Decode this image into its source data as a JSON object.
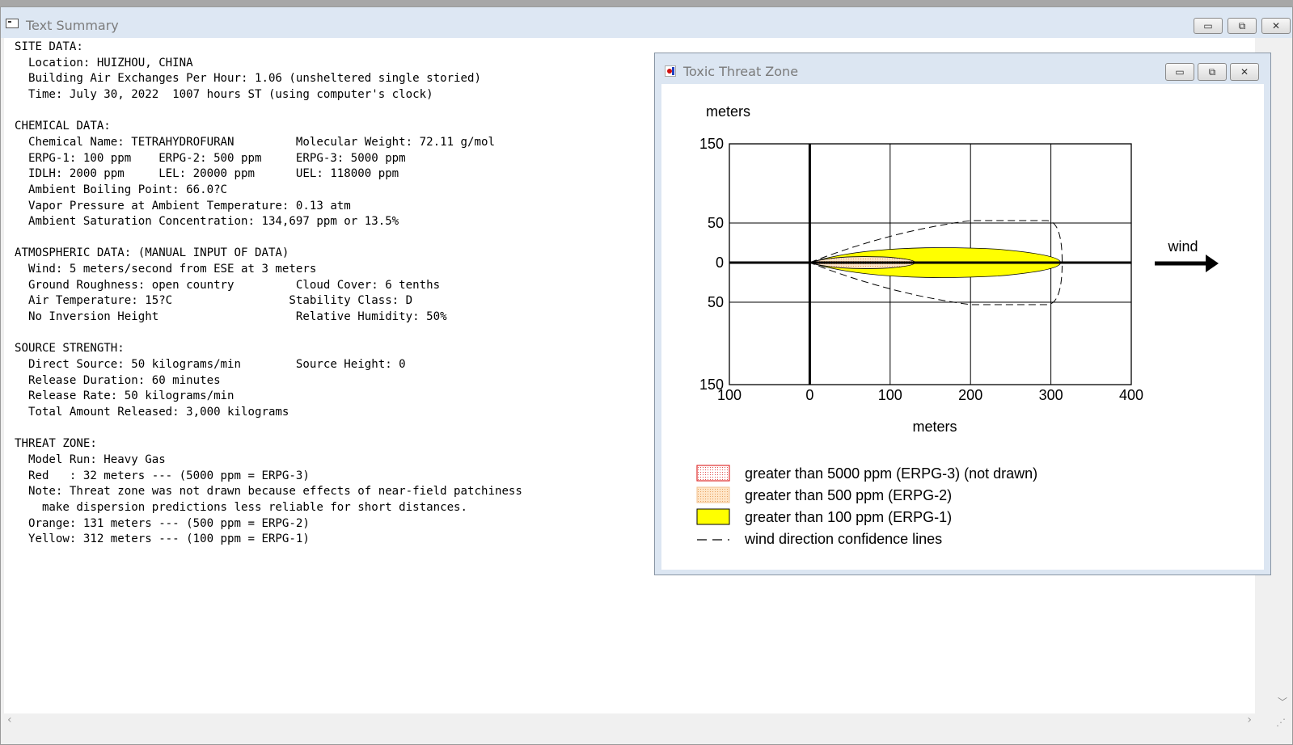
{
  "main_window": {
    "title": "Text Summary",
    "buttons": {
      "minimize": "▭",
      "restore": "⧉",
      "close": "✕"
    }
  },
  "summary_lines": [
    "SITE DATA:",
    "  Location: HUIZHOU, CHINA",
    "  Building Air Exchanges Per Hour: 1.06 (unsheltered single storied)",
    "  Time: July 30, 2022  1007 hours ST (using computer's clock)",
    "",
    "CHEMICAL DATA:",
    "  Chemical Name: TETRAHYDROFURAN         Molecular Weight: 72.11 g/mol",
    "  ERPG-1: 100 ppm    ERPG-2: 500 ppm     ERPG-3: 5000 ppm",
    "  IDLH: 2000 ppm     LEL: 20000 ppm      UEL: 118000 ppm",
    "  Ambient Boiling Point: 66.0?C",
    "  Vapor Pressure at Ambient Temperature: 0.13 atm",
    "  Ambient Saturation Concentration: 134,697 ppm or 13.5%",
    "",
    "ATMOSPHERIC DATA: (MANUAL INPUT OF DATA)",
    "  Wind: 5 meters/second from ESE at 3 meters",
    "  Ground Roughness: open country         Cloud Cover: 6 tenths",
    "  Air Temperature: 15?C                 Stability Class: D",
    "  No Inversion Height                    Relative Humidity: 50%",
    "",
    "SOURCE STRENGTH:",
    "  Direct Source: 50 kilograms/min        Source Height: 0",
    "  Release Duration: 60 minutes",
    "  Release Rate: 50 kilograms/min",
    "  Total Amount Released: 3,000 kilograms",
    "",
    "THREAT ZONE:",
    "  Model Run: Heavy Gas",
    "  Red   : 32 meters --- (5000 ppm = ERPG-3)",
    "  Note: Threat zone was not drawn because effects of near-field patchiness",
    "    make dispersion predictions less reliable for short distances.",
    "  Orange: 131 meters --- (500 ppm = ERPG-2)",
    "  Yellow: 312 meters --- (100 ppm = ERPG-1)"
  ],
  "threat_window": {
    "title": "Toxic Threat Zone",
    "buttons": {
      "minimize": "▭",
      "restore": "⧉",
      "close": "✕"
    }
  },
  "chart_data": {
    "type": "area",
    "y_unit_label": "meters",
    "x_unit_label": "meters",
    "x_ticks": [
      "100",
      "0",
      "100",
      "200",
      "300",
      "400"
    ],
    "y_ticks": [
      "150",
      "50",
      "0",
      "50",
      "150"
    ],
    "xlim": [
      -100,
      400
    ],
    "ylim": [
      -150,
      150
    ],
    "wind_label": "wind",
    "zones": [
      {
        "name": "greater than 100 ppm (ERPG-1)",
        "length_m": 312,
        "halfwidth_m": 20,
        "color": "#ffff00"
      },
      {
        "name": "greater than 500 ppm (ERPG-2)",
        "length_m": 131,
        "halfwidth_m": 8,
        "color": "#ffd8a8"
      }
    ],
    "confidence_lines": {
      "length_m": 312,
      "halfwidth_m": 53
    },
    "legend": [
      {
        "label": "greater than 5000 ppm (ERPG-3) (not drawn)",
        "style": "red-dotted"
      },
      {
        "label": "greater than 500 ppm (ERPG-2)",
        "style": "orange-dotted"
      },
      {
        "label": "greater than 100 ppm (ERPG-1)",
        "style": "yellow"
      },
      {
        "label": "wind direction confidence lines",
        "style": "dash"
      }
    ]
  }
}
